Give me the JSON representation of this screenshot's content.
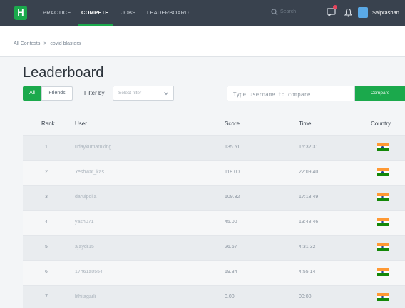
{
  "nav": {
    "logo": "H",
    "items": [
      "PRACTICE",
      "COMPETE",
      "JOBS",
      "LEADERBOARD"
    ],
    "active": "COMPETE",
    "search_placeholder": "Search",
    "username": "Saiprashan"
  },
  "breadcrumb": [
    "All Contests",
    ">",
    "covid blasters"
  ],
  "page": {
    "title": "Leaderboard",
    "btn_all": "All",
    "btn_friends": "Friends",
    "filter_label": "Filter by",
    "filter_placeholder": "Select filter",
    "compare_placeholder": "Type username to compare",
    "compare_button": "Compare"
  },
  "table": {
    "headers": [
      "Rank",
      "User",
      "Score",
      "Time",
      "Country"
    ],
    "rows": [
      {
        "rank": "1",
        "user": "udaykumaruking",
        "score": "135.51",
        "time": "16:32:31",
        "country": "India"
      },
      {
        "rank": "2",
        "user": "Yeshwat_kas",
        "score": "118.00",
        "time": "22:09:40",
        "country": "India"
      },
      {
        "rank": "3",
        "user": "daruipolla",
        "score": "109.32",
        "time": "17:13:49",
        "country": "India"
      },
      {
        "rank": "4",
        "user": "yash071",
        "score": "45.00",
        "time": "13:48:46",
        "country": "India"
      },
      {
        "rank": "5",
        "user": "ajaydr15",
        "score": "26.67",
        "time": "4:31:32",
        "country": "India"
      },
      {
        "rank": "6",
        "user": "17h61a0554",
        "score": "19.34",
        "time": "4:55:14",
        "country": "India"
      },
      {
        "rank": "7",
        "user": "lithilagarli",
        "score": "0.00",
        "time": "00:00",
        "country": "India"
      }
    ]
  },
  "colors": {
    "nav_bg": "#39424e",
    "accent": "#1ba94c"
  }
}
